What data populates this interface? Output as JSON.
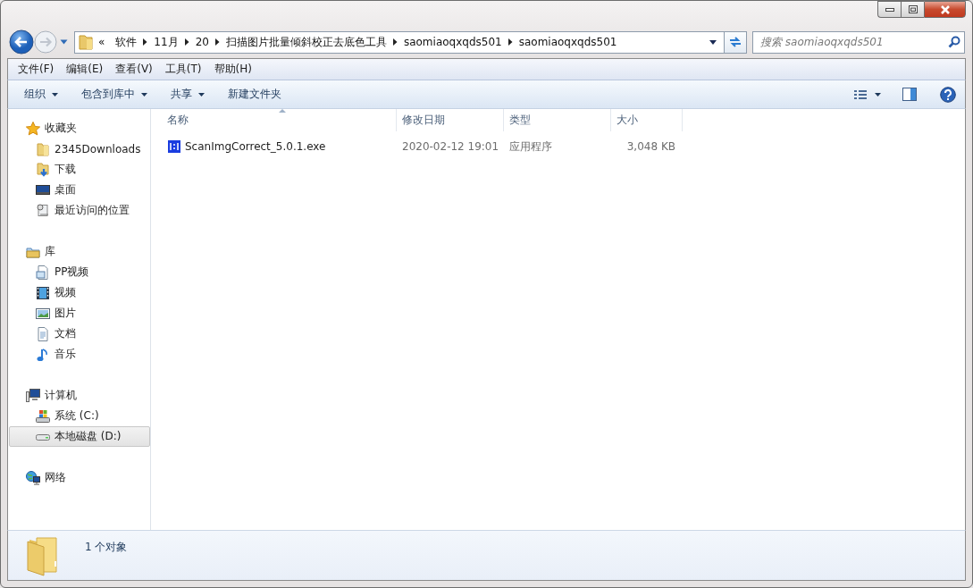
{
  "address_bar": {
    "overflow_mark": "«",
    "crumbs": [
      "软件",
      "11月",
      "20",
      "扫描图片批量倾斜校正去底色工具",
      "saomiaoqxqds501",
      "saomiaoqxqds501"
    ]
  },
  "search": {
    "placeholder": "搜索 saomiaoqxqds501"
  },
  "menu_bar": [
    "文件(F)",
    "编辑(E)",
    "查看(V)",
    "工具(T)",
    "帮助(H)"
  ],
  "toolbar": [
    {
      "label": "组织",
      "dropdown": true
    },
    {
      "label": "包含到库中",
      "dropdown": true
    },
    {
      "label": "共享",
      "dropdown": true
    },
    {
      "label": "新建文件夹",
      "dropdown": false
    }
  ],
  "sidebar": {
    "groups": [
      {
        "label": "收藏夹",
        "items": [
          {
            "label": "2345Downloads",
            "selected": false
          },
          {
            "label": "下载",
            "selected": false
          },
          {
            "label": "桌面",
            "selected": false
          },
          {
            "label": "最近访问的位置",
            "selected": false
          }
        ]
      },
      {
        "label": "库",
        "items": [
          {
            "label": "PP视频",
            "selected": false
          },
          {
            "label": "视频",
            "selected": false
          },
          {
            "label": "图片",
            "selected": false
          },
          {
            "label": "文档",
            "selected": false
          },
          {
            "label": "音乐",
            "selected": false
          }
        ]
      },
      {
        "label": "计算机",
        "items": [
          {
            "label": "系统 (C:)",
            "selected": false
          },
          {
            "label": "本地磁盘 (D:)",
            "selected": true
          }
        ]
      },
      {
        "label": "网络"
      }
    ]
  },
  "table": {
    "columns": [
      {
        "label": "名称",
        "sorted": true
      },
      {
        "label": "修改日期",
        "sorted": false
      },
      {
        "label": "类型",
        "sorted": false
      },
      {
        "label": "大小",
        "sorted": false
      }
    ],
    "rows": [
      {
        "name": "ScanImgCorrect_5.0.1.exe",
        "modified": "2020-02-12 19:01",
        "type": "应用程序",
        "size": "3,048 KB"
      }
    ]
  },
  "status_bar": {
    "text": "1 个对象"
  }
}
